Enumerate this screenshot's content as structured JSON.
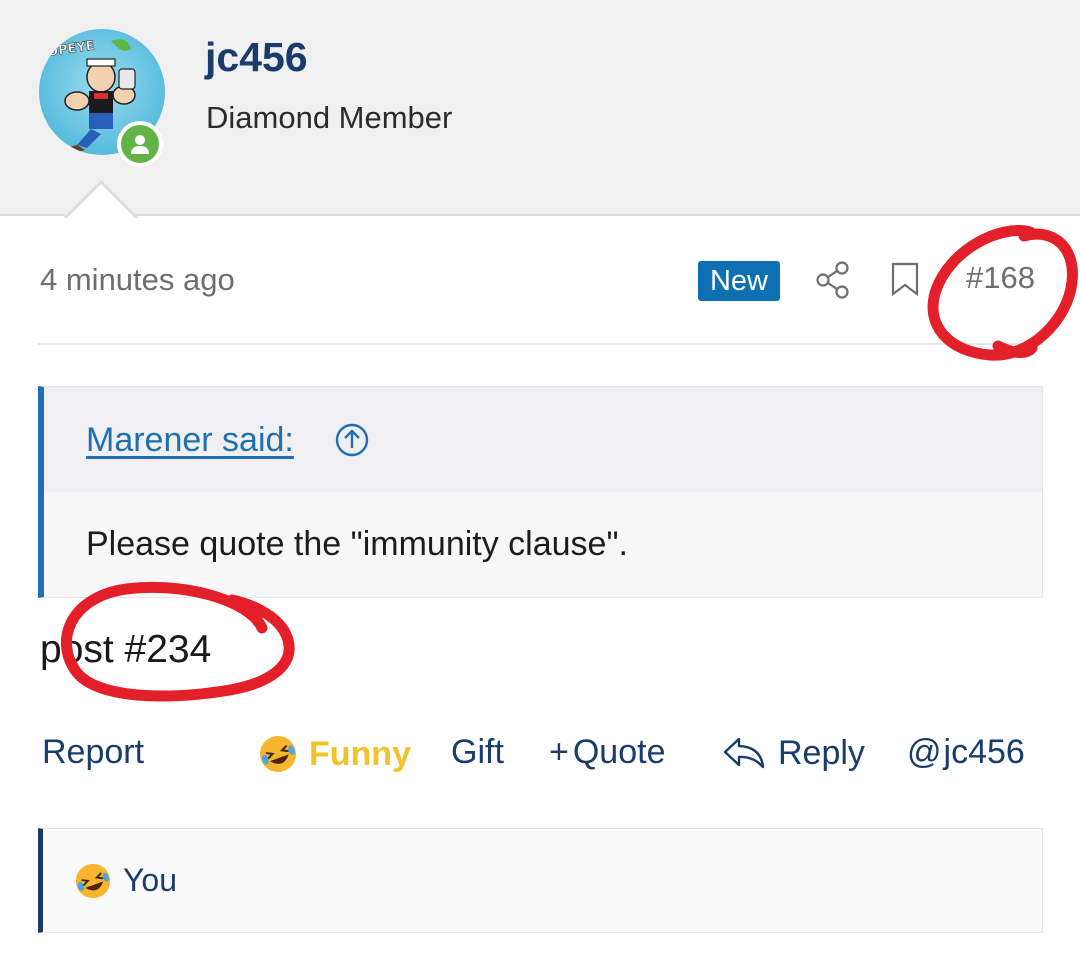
{
  "user": {
    "name": "jc456",
    "title": "Diamond Member",
    "avatar_logo_text": "OPEYE"
  },
  "post_meta": {
    "time": "4 minutes ago",
    "badge": "New",
    "number": "#168"
  },
  "quote": {
    "author": "Marener said:",
    "text": "Please quote the \"immunity clause\"."
  },
  "post": {
    "body": "post #234"
  },
  "actions": {
    "report": "Report",
    "funny": "Funny",
    "gift": "Gift",
    "quote_plus": "+",
    "quote": "Quote",
    "reply": "Reply",
    "mention_at": "@",
    "mention": "jc456"
  },
  "reactions": {
    "user": "You"
  },
  "colors": {
    "link": "#1f6fb1",
    "username": "#1a3c6c",
    "badge": "#0f6fb3",
    "funny": "#f3c12a",
    "online": "#63b246",
    "annotation": "#e3202a"
  },
  "icons": [
    "online-user-icon",
    "share-icon",
    "bookmark-icon",
    "arrow-up-circle-icon",
    "laughing-emoji-icon",
    "reply-arrow-icon"
  ]
}
